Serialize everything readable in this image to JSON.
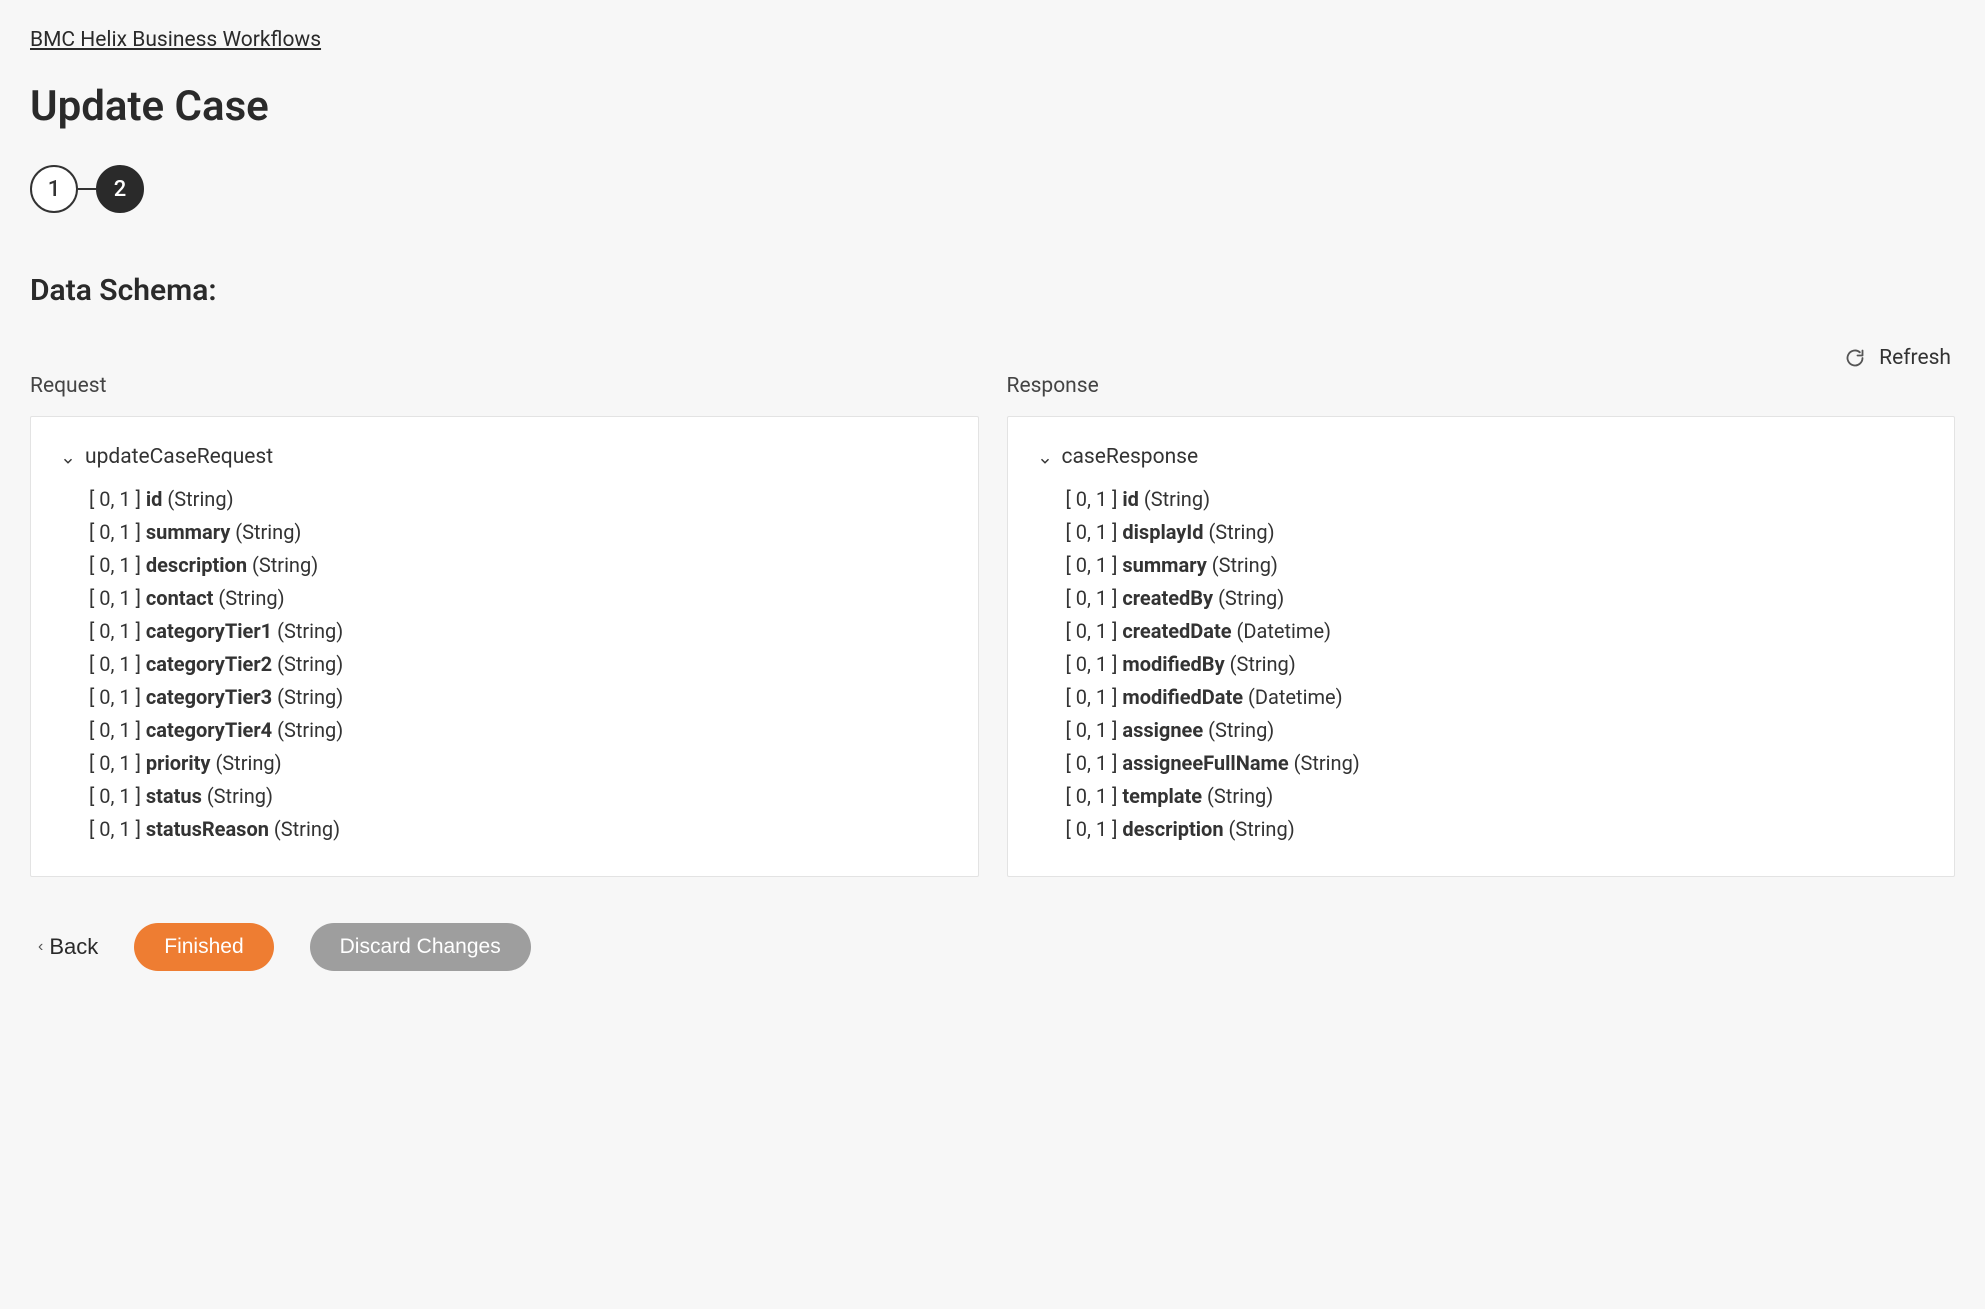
{
  "breadcrumb": "BMC Helix Business Workflows",
  "page_title": "Update Case",
  "stepper": {
    "step1": "1",
    "step2": "2"
  },
  "section_title": "Data Schema:",
  "refresh_label": "Refresh",
  "request": {
    "title": "Request",
    "root": "updateCaseRequest",
    "items": [
      {
        "card": "[ 0, 1 ]",
        "name": "id",
        "type": "(String)"
      },
      {
        "card": "[ 0, 1 ]",
        "name": "summary",
        "type": "(String)"
      },
      {
        "card": "[ 0, 1 ]",
        "name": "description",
        "type": "(String)"
      },
      {
        "card": "[ 0, 1 ]",
        "name": "contact",
        "type": "(String)"
      },
      {
        "card": "[ 0, 1 ]",
        "name": "categoryTier1",
        "type": "(String)"
      },
      {
        "card": "[ 0, 1 ]",
        "name": "categoryTier2",
        "type": "(String)"
      },
      {
        "card": "[ 0, 1 ]",
        "name": "categoryTier3",
        "type": "(String)"
      },
      {
        "card": "[ 0, 1 ]",
        "name": "categoryTier4",
        "type": "(String)"
      },
      {
        "card": "[ 0, 1 ]",
        "name": "priority",
        "type": "(String)"
      },
      {
        "card": "[ 0, 1 ]",
        "name": "status",
        "type": "(String)"
      },
      {
        "card": "[ 0, 1 ]",
        "name": "statusReason",
        "type": "(String)"
      }
    ]
  },
  "response": {
    "title": "Response",
    "root": "caseResponse",
    "items": [
      {
        "card": "[ 0, 1 ]",
        "name": "id",
        "type": "(String)"
      },
      {
        "card": "[ 0, 1 ]",
        "name": "displayId",
        "type": "(String)"
      },
      {
        "card": "[ 0, 1 ]",
        "name": "summary",
        "type": "(String)"
      },
      {
        "card": "[ 0, 1 ]",
        "name": "createdBy",
        "type": "(String)"
      },
      {
        "card": "[ 0, 1 ]",
        "name": "createdDate",
        "type": "(Datetime)"
      },
      {
        "card": "[ 0, 1 ]",
        "name": "modifiedBy",
        "type": "(String)"
      },
      {
        "card": "[ 0, 1 ]",
        "name": "modifiedDate",
        "type": "(Datetime)"
      },
      {
        "card": "[ 0, 1 ]",
        "name": "assignee",
        "type": "(String)"
      },
      {
        "card": "[ 0, 1 ]",
        "name": "assigneeFullName",
        "type": "(String)"
      },
      {
        "card": "[ 0, 1 ]",
        "name": "template",
        "type": "(String)"
      },
      {
        "card": "[ 0, 1 ]",
        "name": "description",
        "type": "(String)"
      }
    ]
  },
  "footer": {
    "back": "Back",
    "finished": "Finished",
    "discard": "Discard Changes"
  }
}
